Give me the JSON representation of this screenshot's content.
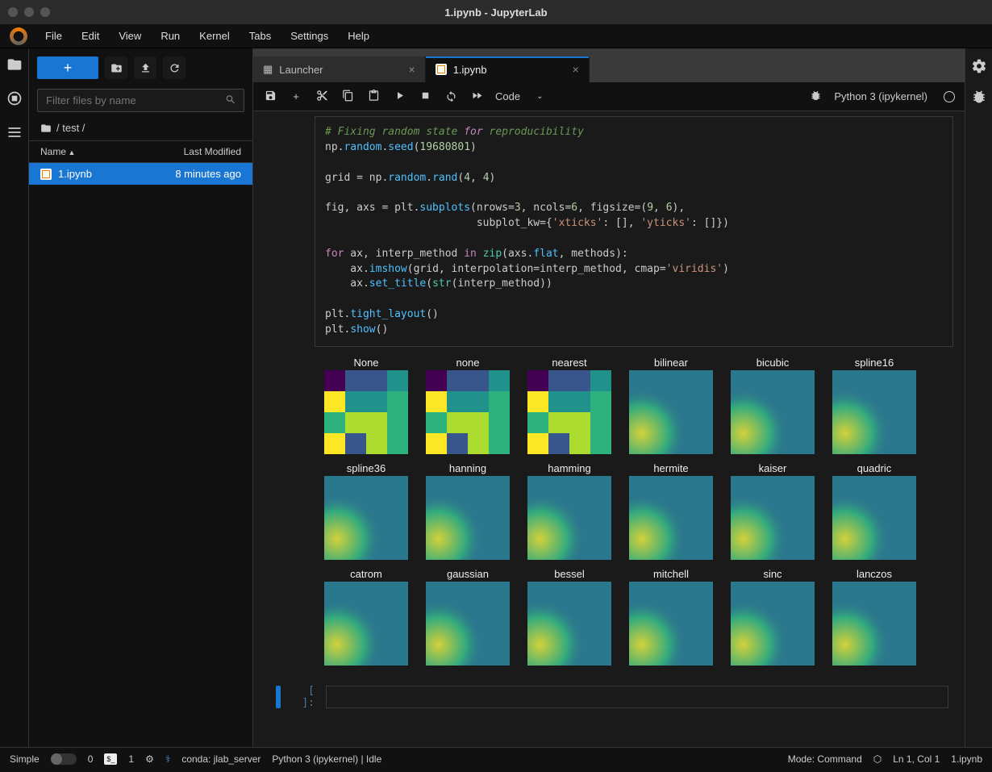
{
  "window_title": "1.ipynb - JupyterLab",
  "menus": [
    "File",
    "Edit",
    "View",
    "Run",
    "Kernel",
    "Tabs",
    "Settings",
    "Help"
  ],
  "filter_placeholder": "Filter files by name",
  "breadcrumb_path": "/ test /",
  "fb_header_name": "Name",
  "fb_header_modified": "Last Modified",
  "file": {
    "name": "1.ipynb",
    "modified": "8 minutes ago"
  },
  "tabs": {
    "launcher": "Launcher",
    "notebook": "1.ipynb"
  },
  "cell_type": "Code",
  "kernel": "Python 3 (ipykernel)",
  "empty_prompt": "[ ]:",
  "code_lines": [
    {
      "t": "comment",
      "s": "# Fixing random state for reproducibility"
    },
    {
      "t": "raw",
      "s": "np.random.seed(19680801)"
    },
    {
      "t": "blank",
      "s": ""
    },
    {
      "t": "raw",
      "s": "grid = np.random.rand(4, 4)"
    },
    {
      "t": "blank",
      "s": ""
    },
    {
      "t": "raw",
      "s": "fig, axs = plt.subplots(nrows=3, ncols=6, figsize=(9, 6),"
    },
    {
      "t": "raw",
      "s": "                        subplot_kw={'xticks': [], 'yticks': []})"
    },
    {
      "t": "blank",
      "s": ""
    },
    {
      "t": "raw",
      "s": "for ax, interp_method in zip(axs.flat, methods):"
    },
    {
      "t": "raw",
      "s": "    ax.imshow(grid, interpolation=interp_method, cmap='viridis')"
    },
    {
      "t": "raw",
      "s": "    ax.set_title(str(interp_method))"
    },
    {
      "t": "blank",
      "s": ""
    },
    {
      "t": "raw",
      "s": "plt.tight_layout()"
    },
    {
      "t": "raw",
      "s": "plt.show()"
    }
  ],
  "plot_titles": [
    "None",
    "none",
    "nearest",
    "bilinear",
    "bicubic",
    "spline16",
    "spline36",
    "hanning",
    "hamming",
    "hermite",
    "kaiser",
    "quadric",
    "catrom",
    "gaussian",
    "bessel",
    "mitchell",
    "sinc",
    "lanczos"
  ],
  "status": {
    "simple": "Simple",
    "counts_a": "0",
    "counts_b": "1",
    "conda": "conda: jlab_server",
    "kernel_status": "Python 3 (ipykernel) | Idle",
    "mode": "Mode: Command",
    "ln": "Ln 1, Col 1",
    "doc": "1.ipynb"
  },
  "chart_data": {
    "type": "heatmap",
    "note": "18 subplots of 4x4 random grid via np.random.rand with seed 19680801 using matplotlib imshow with different interpolation methods and viridis colormap",
    "grid_shape": [
      4,
      4
    ],
    "seed": 19680801,
    "cmap": "viridis",
    "nrows": 3,
    "ncols": 6,
    "interpolations": [
      "None",
      "none",
      "nearest",
      "bilinear",
      "bicubic",
      "spline16",
      "spline36",
      "hanning",
      "hamming",
      "hermite",
      "kaiser",
      "quadric",
      "catrom",
      "gaussian",
      "bessel",
      "mitchell",
      "sinc",
      "lanczos"
    ]
  }
}
